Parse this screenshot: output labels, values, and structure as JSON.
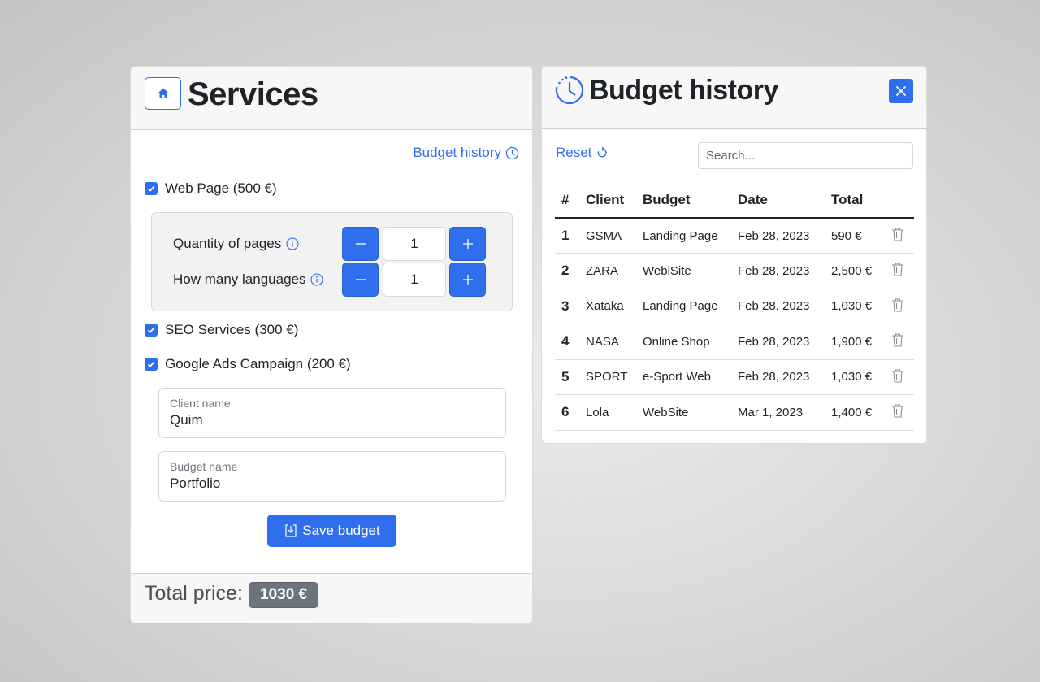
{
  "services": {
    "title": "Services",
    "history_link": "Budget history",
    "web_page": {
      "label": "Web Page (500 €)",
      "checked": true
    },
    "pages": {
      "label": "Quantity of pages",
      "value": "1"
    },
    "languages": {
      "label": "How many languages",
      "value": "1"
    },
    "seo": {
      "label": "SEO Services (300 €)",
      "checked": true
    },
    "ads": {
      "label": "Google Ads Campaign (200 €)",
      "checked": true
    },
    "client_field": {
      "label": "Client name",
      "value": "Quim"
    },
    "budget_field": {
      "label": "Budget name",
      "value": "Portfolio"
    },
    "save_label": "Save budget",
    "total_label": "Total price:",
    "total_value": "1030 €"
  },
  "history": {
    "title": "Budget history",
    "reset_label": "Reset",
    "search_placeholder": "Search...",
    "columns": [
      "#",
      "Client",
      "Budget",
      "Date",
      "Total"
    ],
    "rows": [
      {
        "n": "1",
        "client": "GSMA",
        "budget": "Landing Page",
        "date": "Feb 28, 2023",
        "total": "590 €"
      },
      {
        "n": "2",
        "client": "ZARA",
        "budget": "WebiSite",
        "date": "Feb 28, 2023",
        "total": "2,500 €"
      },
      {
        "n": "3",
        "client": "Xataka",
        "budget": "Landing Page",
        "date": "Feb 28, 2023",
        "total": "1,030 €"
      },
      {
        "n": "4",
        "client": "NASA",
        "budget": "Online Shop",
        "date": "Feb 28, 2023",
        "total": "1,900 €"
      },
      {
        "n": "5",
        "client": "SPORT",
        "budget": "e-Sport Web",
        "date": "Feb 28, 2023",
        "total": "1,030 €"
      },
      {
        "n": "6",
        "client": "Lola",
        "budget": "WebSite",
        "date": "Mar 1, 2023",
        "total": "1,400 €"
      }
    ]
  },
  "colors": {
    "accent": "#2f6fed",
    "badge": "#6c757d",
    "header_bg": "#f7f7f7"
  },
  "icons": [
    "home-icon",
    "clock-icon",
    "close-icon",
    "check-icon",
    "info-icon",
    "minus-icon",
    "plus-icon",
    "download-icon",
    "refresh-icon",
    "trash-icon"
  ]
}
